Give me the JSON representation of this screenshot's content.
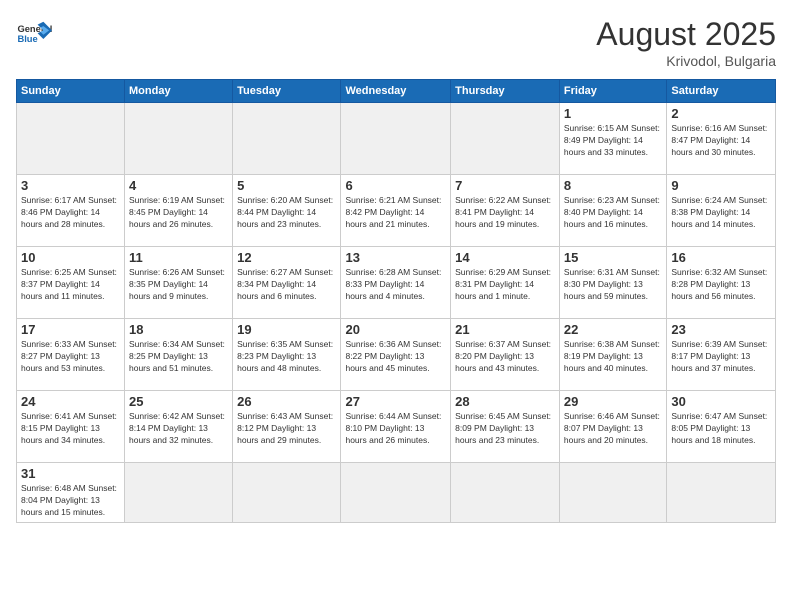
{
  "logo": {
    "general": "General",
    "blue": "Blue"
  },
  "title": {
    "month_year": "August 2025",
    "location": "Krivodol, Bulgaria"
  },
  "weekdays": [
    "Sunday",
    "Monday",
    "Tuesday",
    "Wednesday",
    "Thursday",
    "Friday",
    "Saturday"
  ],
  "weeks": [
    [
      {
        "day": "",
        "info": ""
      },
      {
        "day": "",
        "info": ""
      },
      {
        "day": "",
        "info": ""
      },
      {
        "day": "",
        "info": ""
      },
      {
        "day": "",
        "info": ""
      },
      {
        "day": "1",
        "info": "Sunrise: 6:15 AM\nSunset: 8:49 PM\nDaylight: 14 hours and 33 minutes."
      },
      {
        "day": "2",
        "info": "Sunrise: 6:16 AM\nSunset: 8:47 PM\nDaylight: 14 hours and 30 minutes."
      }
    ],
    [
      {
        "day": "3",
        "info": "Sunrise: 6:17 AM\nSunset: 8:46 PM\nDaylight: 14 hours and 28 minutes."
      },
      {
        "day": "4",
        "info": "Sunrise: 6:19 AM\nSunset: 8:45 PM\nDaylight: 14 hours and 26 minutes."
      },
      {
        "day": "5",
        "info": "Sunrise: 6:20 AM\nSunset: 8:44 PM\nDaylight: 14 hours and 23 minutes."
      },
      {
        "day": "6",
        "info": "Sunrise: 6:21 AM\nSunset: 8:42 PM\nDaylight: 14 hours and 21 minutes."
      },
      {
        "day": "7",
        "info": "Sunrise: 6:22 AM\nSunset: 8:41 PM\nDaylight: 14 hours and 19 minutes."
      },
      {
        "day": "8",
        "info": "Sunrise: 6:23 AM\nSunset: 8:40 PM\nDaylight: 14 hours and 16 minutes."
      },
      {
        "day": "9",
        "info": "Sunrise: 6:24 AM\nSunset: 8:38 PM\nDaylight: 14 hours and 14 minutes."
      }
    ],
    [
      {
        "day": "10",
        "info": "Sunrise: 6:25 AM\nSunset: 8:37 PM\nDaylight: 14 hours and 11 minutes."
      },
      {
        "day": "11",
        "info": "Sunrise: 6:26 AM\nSunset: 8:35 PM\nDaylight: 14 hours and 9 minutes."
      },
      {
        "day": "12",
        "info": "Sunrise: 6:27 AM\nSunset: 8:34 PM\nDaylight: 14 hours and 6 minutes."
      },
      {
        "day": "13",
        "info": "Sunrise: 6:28 AM\nSunset: 8:33 PM\nDaylight: 14 hours and 4 minutes."
      },
      {
        "day": "14",
        "info": "Sunrise: 6:29 AM\nSunset: 8:31 PM\nDaylight: 14 hours and 1 minute."
      },
      {
        "day": "15",
        "info": "Sunrise: 6:31 AM\nSunset: 8:30 PM\nDaylight: 13 hours and 59 minutes."
      },
      {
        "day": "16",
        "info": "Sunrise: 6:32 AM\nSunset: 8:28 PM\nDaylight: 13 hours and 56 minutes."
      }
    ],
    [
      {
        "day": "17",
        "info": "Sunrise: 6:33 AM\nSunset: 8:27 PM\nDaylight: 13 hours and 53 minutes."
      },
      {
        "day": "18",
        "info": "Sunrise: 6:34 AM\nSunset: 8:25 PM\nDaylight: 13 hours and 51 minutes."
      },
      {
        "day": "19",
        "info": "Sunrise: 6:35 AM\nSunset: 8:23 PM\nDaylight: 13 hours and 48 minutes."
      },
      {
        "day": "20",
        "info": "Sunrise: 6:36 AM\nSunset: 8:22 PM\nDaylight: 13 hours and 45 minutes."
      },
      {
        "day": "21",
        "info": "Sunrise: 6:37 AM\nSunset: 8:20 PM\nDaylight: 13 hours and 43 minutes."
      },
      {
        "day": "22",
        "info": "Sunrise: 6:38 AM\nSunset: 8:19 PM\nDaylight: 13 hours and 40 minutes."
      },
      {
        "day": "23",
        "info": "Sunrise: 6:39 AM\nSunset: 8:17 PM\nDaylight: 13 hours and 37 minutes."
      }
    ],
    [
      {
        "day": "24",
        "info": "Sunrise: 6:41 AM\nSunset: 8:15 PM\nDaylight: 13 hours and 34 minutes."
      },
      {
        "day": "25",
        "info": "Sunrise: 6:42 AM\nSunset: 8:14 PM\nDaylight: 13 hours and 32 minutes."
      },
      {
        "day": "26",
        "info": "Sunrise: 6:43 AM\nSunset: 8:12 PM\nDaylight: 13 hours and 29 minutes."
      },
      {
        "day": "27",
        "info": "Sunrise: 6:44 AM\nSunset: 8:10 PM\nDaylight: 13 hours and 26 minutes."
      },
      {
        "day": "28",
        "info": "Sunrise: 6:45 AM\nSunset: 8:09 PM\nDaylight: 13 hours and 23 minutes."
      },
      {
        "day": "29",
        "info": "Sunrise: 6:46 AM\nSunset: 8:07 PM\nDaylight: 13 hours and 20 minutes."
      },
      {
        "day": "30",
        "info": "Sunrise: 6:47 AM\nSunset: 8:05 PM\nDaylight: 13 hours and 18 minutes."
      }
    ],
    [
      {
        "day": "31",
        "info": "Sunrise: 6:48 AM\nSunset: 8:04 PM\nDaylight: 13 hours and 15 minutes."
      },
      {
        "day": "",
        "info": ""
      },
      {
        "day": "",
        "info": ""
      },
      {
        "day": "",
        "info": ""
      },
      {
        "day": "",
        "info": ""
      },
      {
        "day": "",
        "info": ""
      },
      {
        "day": "",
        "info": ""
      }
    ]
  ]
}
